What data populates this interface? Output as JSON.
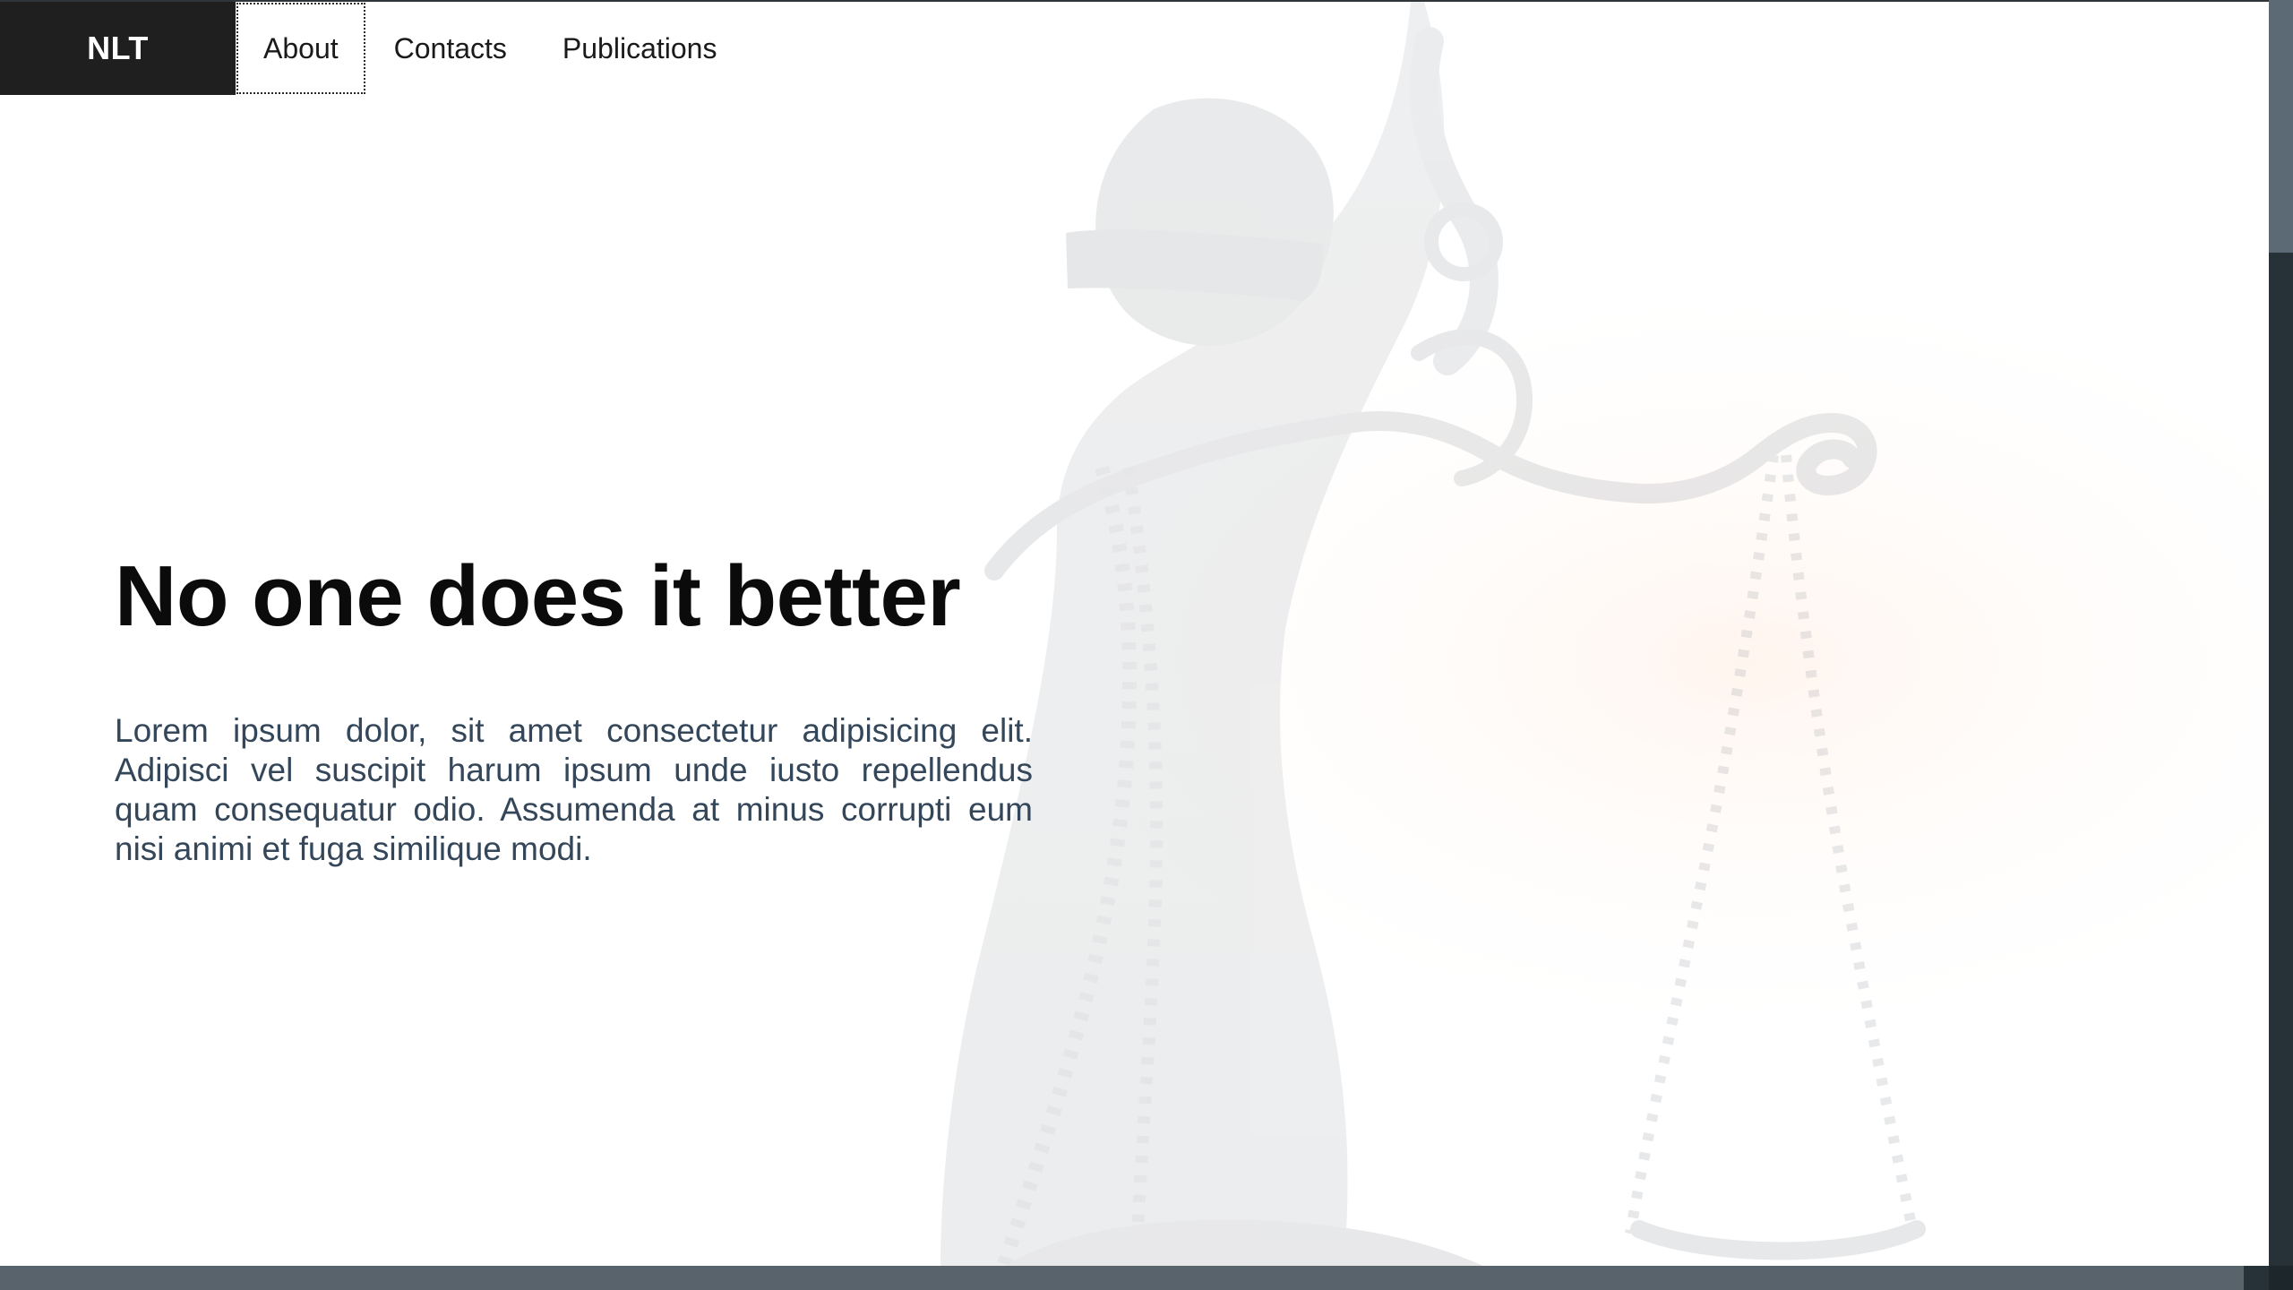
{
  "app": {
    "brand": "NLT"
  },
  "nav": {
    "items": [
      {
        "label": "About",
        "active": true
      },
      {
        "label": "Contacts",
        "active": false
      },
      {
        "label": "Publications",
        "active": false
      }
    ]
  },
  "hero": {
    "title": "No one does it better",
    "body": "Lorem ipsum dolor, sit amet consectetur adipisicing elit. Adipisci vel suscipit harum ipsum unde iusto repellendus quam consequatur odio. Assumenda at minus corrupti eum nisi animi et fuga similique modi.",
    "background_image": "statue-of-justice-icon"
  },
  "scrollbars": {
    "vertical_thumb_fraction": 0.2,
    "horizontal_thumb_fraction": 0.99
  },
  "colors": {
    "nav_brand_bg": "#1f1f1f",
    "title": "#0b0b0b",
    "body_text": "#34475a",
    "scrollbar_track": "#263238",
    "scrollbar_thumb": "#5b6a74"
  }
}
